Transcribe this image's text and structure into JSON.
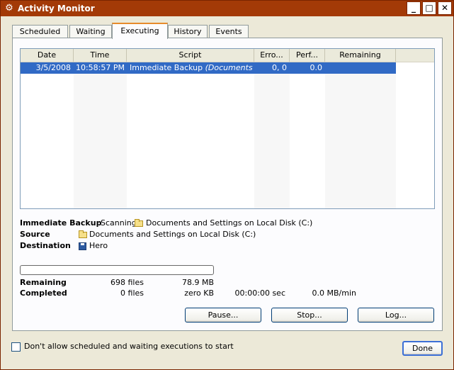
{
  "window": {
    "title": "Activity Monitor"
  },
  "title_buttons": {
    "minimize": "_",
    "maximize": "□",
    "close": "✕"
  },
  "tabs": [
    {
      "label": "Scheduled"
    },
    {
      "label": "Waiting"
    },
    {
      "label": "Executing",
      "active": true
    },
    {
      "label": "History"
    },
    {
      "label": "Events"
    }
  ],
  "table": {
    "columns": [
      "Date",
      "Time",
      "Script",
      "Erro...",
      "Perf...",
      "Remaining"
    ],
    "rows": [
      {
        "date": "3/5/2008",
        "time": "10:58:57 PM",
        "script": "Immediate Backup",
        "script_detail": "(Documents and S",
        "errors": "0, 0",
        "perf": "0.0",
        "remaining": ""
      }
    ]
  },
  "status": {
    "task_label": "Immediate Backup",
    "task_action": "Scanning",
    "task_path": "Documents and Settings on Local Disk (C:)",
    "source_label": "Source",
    "source_path": "Documents and Settings on Local Disk (C:)",
    "destination_label": "Destination",
    "destination_value": "Hero"
  },
  "progress": {
    "fraction": 0
  },
  "stats": {
    "remaining_label": "Remaining",
    "remaining_files": "698 files",
    "remaining_size": "78.9 MB",
    "completed_label": "Completed",
    "completed_files": "0 files",
    "completed_size": "zero KB",
    "elapsed": "00:00:00 sec",
    "rate": "0.0 MB/min"
  },
  "buttons": {
    "pause": "Pause...",
    "stop": "Stop...",
    "log": "Log...",
    "done": "Done"
  },
  "checkbox": {
    "label": "Don't allow scheduled and waiting executions to start",
    "checked": false
  },
  "icons": {
    "app": "gear-icon",
    "folder": "folder-icon",
    "destination": "disk-icon"
  },
  "colors": {
    "titlebar": "#a33a07",
    "selection": "#316ac5",
    "tab_accent": "#e68b2c",
    "progress": "#2bd22b"
  }
}
